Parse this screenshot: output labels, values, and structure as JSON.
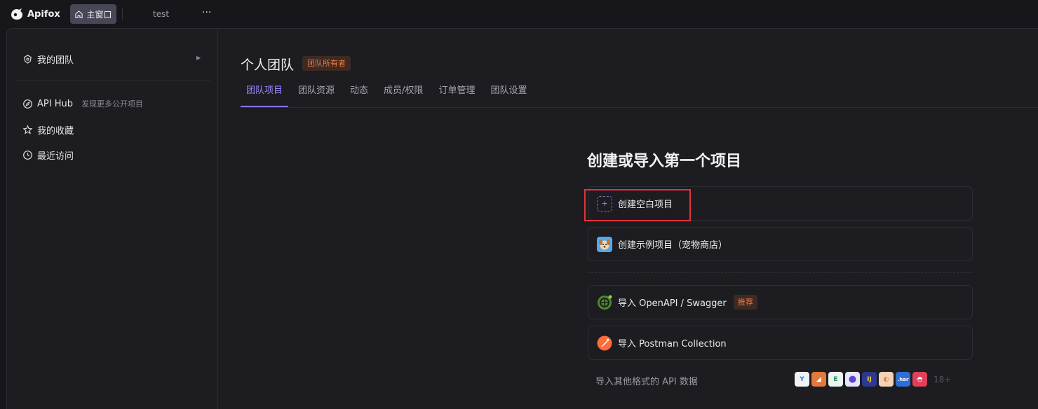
{
  "topbar": {
    "app_name": "Apifox",
    "home_tab_label": "主窗口",
    "open_tab_label": "test",
    "more_label": "···"
  },
  "sidebar": {
    "items": [
      {
        "label": "我的团队",
        "icon": "team-icon"
      },
      {
        "label": "API Hub",
        "hint": "发现更多公开项目",
        "icon": "compass-icon"
      },
      {
        "label": "我的收藏",
        "icon": "star-icon"
      },
      {
        "label": "最近访问",
        "icon": "clock-icon"
      }
    ]
  },
  "team": {
    "title": "个人团队",
    "role_badge": "团队所有者",
    "tabs": [
      {
        "label": "团队项目",
        "active": true
      },
      {
        "label": "团队资源",
        "active": false
      },
      {
        "label": "动态",
        "active": false
      },
      {
        "label": "成员/权限",
        "active": false
      },
      {
        "label": "订单管理",
        "active": false
      },
      {
        "label": "团队设置",
        "active": false
      }
    ]
  },
  "create": {
    "heading": "创建或导入第一个项目",
    "blank_project": "创建空白项目",
    "sample_project": "创建示例项目（宠物商店）",
    "import_openapi": "导入 OpenAPI / Swagger",
    "recommend_badge": "推荐",
    "import_postman": "导入 Postman Collection",
    "other_formats": "导入其他格式的 API 数据",
    "more_count": "18+",
    "format_icons": [
      {
        "name": "yapi-icon",
        "color": "#2f7ee8",
        "glyph": "Y"
      },
      {
        "name": "rap-icon",
        "color": "#e27a3b",
        "glyph": "◢"
      },
      {
        "name": "eolink-icon",
        "color": "#1f8a5e",
        "glyph": "E"
      },
      {
        "name": "showdoc-icon",
        "color": "#5b45d6",
        "glyph": "●"
      },
      {
        "name": "jmeter-icon",
        "color": "#2b3a8e",
        "glyph": "IJ"
      },
      {
        "name": "insomnia-icon",
        "color": "#d97f52",
        "glyph": "◐"
      },
      {
        "name": "har-icon",
        "color": "#2d6fd3",
        "glyph": ".har"
      },
      {
        "name": "apipost-icon",
        "color": "#e0405a",
        "glyph": "◓"
      }
    ]
  },
  "colors": {
    "accent": "#8b74f5",
    "badge_text": "#ef7b45",
    "highlight": "#e2333a"
  }
}
